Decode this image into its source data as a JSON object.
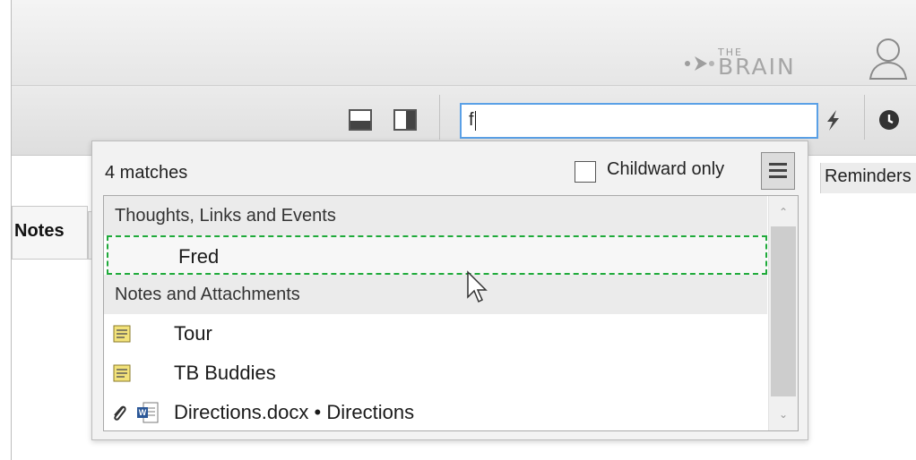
{
  "branding": {
    "the": "THE",
    "brain": "BRAIN"
  },
  "icons": {
    "user": "user-icon",
    "layout_bottom": "layout-bottom-panel-icon",
    "layout_right": "layout-right-panel-icon",
    "lightning": "lightning-icon",
    "clock": "clock-icon",
    "menu": "hamburger-menu-icon",
    "note": "note-icon",
    "paperclip": "paperclip-icon",
    "word_doc": "word-document-icon"
  },
  "search": {
    "value": "f"
  },
  "tabs": {
    "notes_label": "Notes",
    "reminders_label": "Reminders"
  },
  "dropdown": {
    "matches_label": "4 matches",
    "childward_label": "Childward only",
    "childward_checked": false,
    "groups": [
      {
        "label": "Thoughts, Links and Events",
        "items": [
          {
            "label": "Fred",
            "selected": true
          }
        ]
      },
      {
        "label": "Notes and Attachments",
        "items": [
          {
            "label": "Tour",
            "icon": "note-icon"
          },
          {
            "label": "TB Buddies",
            "icon": "note-icon"
          },
          {
            "label": "Directions.docx • Directions",
            "icon": "paperclip-icon"
          }
        ]
      }
    ]
  },
  "colors": {
    "selection_border": "#1faa3a",
    "search_border": "#5aa0e6",
    "note_icon": "#f2e27a"
  }
}
